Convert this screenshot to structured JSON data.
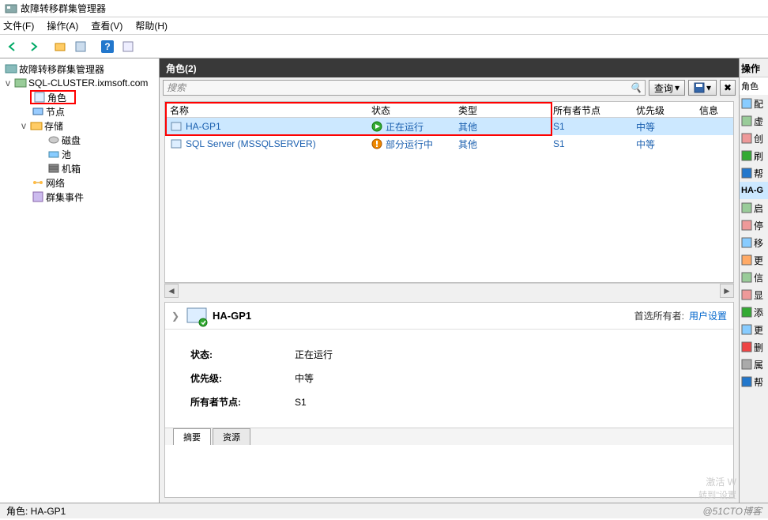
{
  "window_title": "故障转移群集管理器",
  "menu": {
    "file": "文件(F)",
    "action": "操作(A)",
    "view": "查看(V)",
    "help": "帮助(H)"
  },
  "tree": {
    "root": "故障转移群集管理器",
    "cluster": "SQL-CLUSTER.ixmsoft.com",
    "roles": "角色",
    "nodes": "节点",
    "storage": "存储",
    "disks": "磁盘",
    "pools": "池",
    "chassis": "机箱",
    "networks": "网络",
    "events": "群集事件"
  },
  "center": {
    "header": "角色(2)",
    "search_placeholder": "搜索",
    "btn_query": "查询",
    "cols": {
      "name": "名称",
      "status": "状态",
      "type": "类型",
      "owner": "所有者节点",
      "priority": "优先级",
      "info": "信息"
    },
    "rows": [
      {
        "name": "HA-GP1",
        "status": "正在运行",
        "status_icon": "running",
        "type": "其他",
        "owner": "S1",
        "priority": "中等",
        "selected": true
      },
      {
        "name": "SQL Server (MSSQLSERVER)",
        "status": "部分运行中",
        "status_icon": "partial",
        "type": "其他",
        "owner": "S1",
        "priority": "中等",
        "selected": false
      }
    ]
  },
  "details": {
    "title": "HA-GP1",
    "pref_owner_label": "首选所有者:",
    "pref_owner_link": "用户设置",
    "fields": {
      "status_label": "状态:",
      "status_value": "正在运行",
      "priority_label": "优先级:",
      "priority_value": "中等",
      "owner_label": "所有者节点:",
      "owner_value": "S1"
    },
    "tabs": {
      "summary": "摘要",
      "resources": "资源"
    }
  },
  "actions_pane": {
    "header": "操作",
    "group1": "角色",
    "items1": [
      "配",
      "虚",
      "创",
      "刷",
      "帮"
    ],
    "sel": "HA-G",
    "items2": [
      "启",
      "停",
      "移",
      "更",
      "信",
      "显",
      "添",
      "更",
      "删",
      "属",
      "帮"
    ]
  },
  "status_bar": "角色: HA-GP1",
  "blog": "@51CTO博客",
  "watermark": {
    "l1": "激活 W",
    "l2": "转到\"设置"
  }
}
